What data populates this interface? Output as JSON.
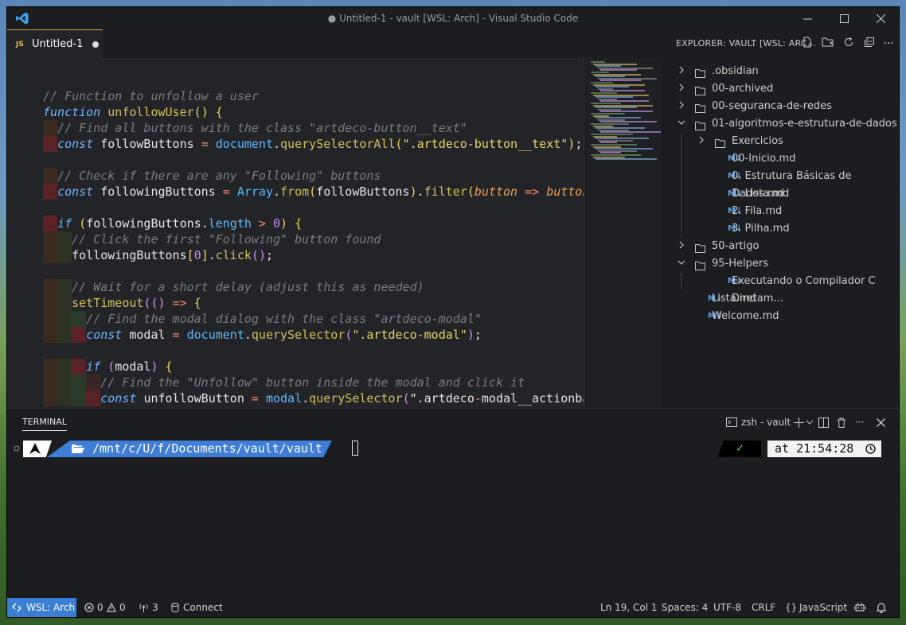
{
  "window": {
    "title": "● Untitled-1 - vault [WSL: Arch] - Visual Studio Code"
  },
  "tab": {
    "lang": "JS",
    "name": "Untitled-1"
  },
  "code_lines": [
    "",
    "// Function to unfollow a user",
    "function unfollowUser() {",
    "  // Find all buttons with the class \"artdeco-button__text\"",
    "  const followButtons = document.querySelectorAll(\".artdeco-button__text\");",
    "",
    "  // Check if there are any \"Following\" buttons",
    "  const followingButtons = Array.from(followButtons).filter(button => button",
    "",
    "  if (followingButtons.length > 0) {",
    "    // Click the first \"Following\" button found",
    "    followingButtons[0].click();",
    "",
    "    // Wait for a short delay (adjust this as needed)",
    "    setTimeout(() => {",
    "      // Find the modal dialog with the class \"artdeco-modal\"",
    "      const modal = document.querySelector(\".artdeco-modal\");",
    "",
    "      if (modal) {",
    "        // Find the \"Unfollow\" button inside the modal and click it",
    "        const unfollowButton = modal.querySelector(\".artdeco-modal__actionba"
  ],
  "explorer": {
    "title": "EXPLORER: VAULT [WSL: ARC...",
    "items": [
      {
        "label": ".obsidian",
        "kind": "folder",
        "open": false,
        "depth": 0
      },
      {
        "label": "00-archived",
        "kind": "folder",
        "open": false,
        "depth": 0
      },
      {
        "label": "00-seguranca-de-redes",
        "kind": "folder",
        "open": false,
        "depth": 0
      },
      {
        "label": "01-algoritmos-e-estrutura-de-dados",
        "kind": "folder",
        "open": true,
        "depth": 0
      },
      {
        "label": "Exercicios",
        "kind": "folder",
        "open": false,
        "depth": 1
      },
      {
        "label": "00-Inicio.md",
        "kind": "md",
        "depth": 1
      },
      {
        "label": "0. Estrutura Básicas de Dados.md",
        "kind": "md",
        "depth": 1
      },
      {
        "label": "1. Lista.md",
        "kind": "md",
        "depth": 1
      },
      {
        "label": "2. Fila.md",
        "kind": "md",
        "depth": 1
      },
      {
        "label": "3. Pilha.md",
        "kind": "md",
        "depth": 1
      },
      {
        "label": "50-artigo",
        "kind": "folder",
        "open": false,
        "depth": 0
      },
      {
        "label": "95-Helpers",
        "kind": "folder",
        "open": true,
        "depth": 0
      },
      {
        "label": "Executando o Compilador C Diretam...",
        "kind": "md",
        "depth": 1
      },
      {
        "label": "Lista.md",
        "kind": "md",
        "depth": 0
      },
      {
        "label": "Welcome.md",
        "kind": "md",
        "depth": 0
      }
    ]
  },
  "panel": {
    "tab": "TERMINAL",
    "shell": "zsh - vault",
    "prompt_path": "/mnt/c/U/f/Documents/vault/vault",
    "check": "✓",
    "time": "at 21:54:28"
  },
  "status": {
    "remote": "WSL: Arch",
    "errors": "0",
    "warnings": "0",
    "ports": "3",
    "connect": "Connect",
    "position": "Ln 19, Col 1",
    "spaces": "Spaces: 4",
    "encoding": "UTF-8",
    "eol": "CRLF",
    "language": "JavaScript"
  },
  "colors": {
    "accent_tab": "#e8a33d",
    "remote_bg": "#3b7fd4",
    "prompt_bg": "#3f7dd6"
  }
}
